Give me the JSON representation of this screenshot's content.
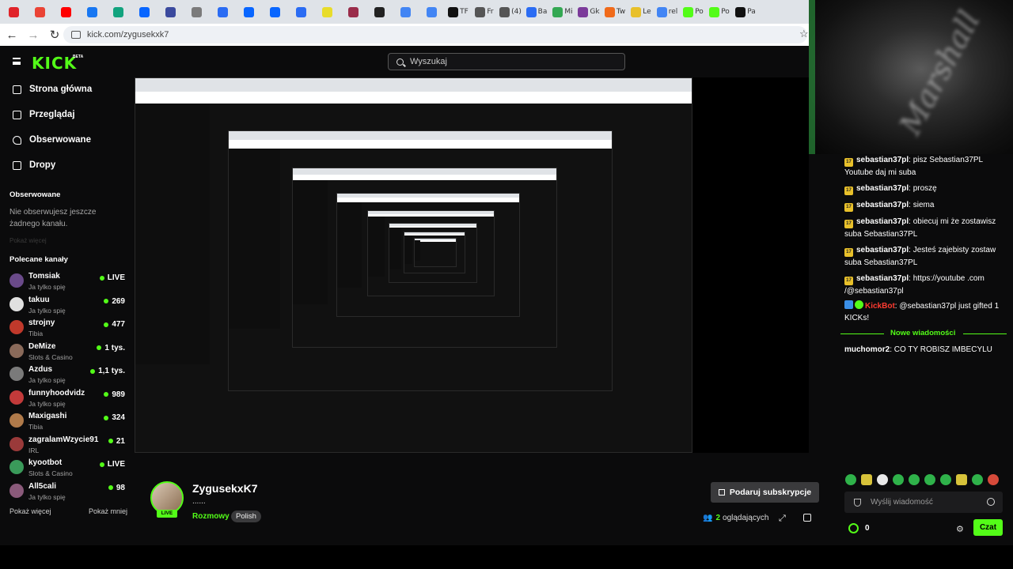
{
  "browser": {
    "tabs": [
      {
        "label": "",
        "color": "#e0242a"
      },
      {
        "label": "",
        "color": "#ea4335"
      },
      {
        "label": "",
        "color": "#ff0000"
      },
      {
        "label": "",
        "color": "#1877f2"
      },
      {
        "label": "",
        "color": "#12a37e"
      },
      {
        "label": "",
        "color": "#0866ff"
      },
      {
        "label": "",
        "color": "#3b4a9e"
      },
      {
        "label": "",
        "color": "#7b7b7b"
      },
      {
        "label": "",
        "color": "#2b6cf3"
      },
      {
        "label": "",
        "color": "#0866ff"
      },
      {
        "label": "",
        "color": "#0866ff"
      },
      {
        "label": "",
        "color": "#2b6cf3"
      },
      {
        "label": "",
        "color": "#e8dc2a"
      },
      {
        "label": "",
        "color": "#9a2c4a"
      },
      {
        "label": "",
        "color": "#222222"
      },
      {
        "label": "",
        "color": "#4285f4"
      },
      {
        "label": "",
        "color": "#4285f4"
      },
      {
        "label": "TF",
        "color": "#111111"
      },
      {
        "label": "Fr",
        "color": "#555555"
      },
      {
        "label": "(4)",
        "color": "#555555"
      },
      {
        "label": "Ba",
        "color": "#2b6cf3"
      },
      {
        "label": "Mi",
        "color": "#34a853"
      },
      {
        "label": "Gk",
        "color": "#7b3a9a"
      },
      {
        "label": "Tw",
        "color": "#f06a1a"
      },
      {
        "label": "Le",
        "color": "#e8c02a"
      },
      {
        "label": "rel",
        "color": "#4285f4"
      },
      {
        "label": "Po",
        "color": "#53fc18"
      },
      {
        "label": "Po",
        "color": "#53fc18"
      },
      {
        "label": "Pa",
        "color": "#111111"
      }
    ],
    "url": "kick.com/zygusekxk7"
  },
  "header": {
    "logo": "KICK",
    "beta": "BETA",
    "search_placeholder": "Wyszukaj"
  },
  "sidebar": {
    "nav": [
      {
        "label": "Strona główna",
        "icon": "home-icon"
      },
      {
        "label": "Przeglądaj",
        "icon": "browse-icon"
      },
      {
        "label": "Obserwowane",
        "icon": "heart-icon"
      },
      {
        "label": "Dropy",
        "icon": "gift-icon"
      }
    ],
    "followed_title": "Obserwowane",
    "followed_empty": "Nie obserwujesz jeszcze żadnego kanału.",
    "followed_faded": "Pokaż więcej",
    "recommended_title": "Polecane kanały",
    "channels": [
      {
        "name": "Tomsiak",
        "category": "Ja tylko spię",
        "count": "LIVE",
        "color": "#6a4a8a"
      },
      {
        "name": "takuu",
        "category": "Ja tylko spię",
        "count": "269",
        "color": "#e0e0e0"
      },
      {
        "name": "strojny",
        "category": "Tibia",
        "count": "477",
        "color": "#c0392b"
      },
      {
        "name": "DeMize",
        "category": "Slots & Casino",
        "count": "1 tys.",
        "color": "#8a6a5a"
      },
      {
        "name": "Azdus",
        "category": "Ja tylko spię",
        "count": "1,1 tys.",
        "color": "#7a7a7a"
      },
      {
        "name": "funnyhoodvidz",
        "category": "Ja tylko spię",
        "count": "989",
        "color": "#c23a3a"
      },
      {
        "name": "Maxigashi",
        "category": "Tibia",
        "count": "324",
        "color": "#b07a4a"
      },
      {
        "name": "zagralamWzycie91",
        "category": "IRL",
        "count": "21",
        "color": "#9a3a3a"
      },
      {
        "name": "kyootbot",
        "category": "Slots & Casino",
        "count": "LIVE",
        "color": "#3a9a5a"
      },
      {
        "name": "All5cali",
        "category": "Ja tylko spię",
        "count": "98",
        "color": "#8a5a7a"
      }
    ],
    "show_more": "Pokaż więcej",
    "show_less": "Pokaż mniej"
  },
  "channel": {
    "name": "ZygusekxK7",
    "title": "......",
    "live": "LIVE",
    "category": "Rozmowy",
    "language": "Polish",
    "subscribe_label": "Podaruj subskrypcje",
    "viewers_count": "2",
    "viewers_label": "oglądających"
  },
  "chat": {
    "messages": [
      {
        "user": "sebastian37pl",
        "text": "pisz Sebastian37PL Youtube daj mi suba"
      },
      {
        "user": "sebastian37pl",
        "text": "proszę"
      },
      {
        "user": "sebastian37pl",
        "text": "siema"
      },
      {
        "user": "sebastian37pl",
        "text": "obiecuj mi że zostawisz suba Sebastian37PL"
      },
      {
        "user": "sebastian37pl",
        "text": "Jesteś zajebisty zostaw suba Sebastian37PL"
      },
      {
        "user": "sebastian37pl",
        "text": "https://youtube .com /@sebastian37pl"
      }
    ],
    "bot_message": {
      "user": "KickBot",
      "text": "@sebastian37pl just gifted 1 KICKs!"
    },
    "new_messages_label": "Nowe wiadomości",
    "last_message": {
      "user": "muchomor2",
      "text": "CO TY ROBISZ IMBECYLU"
    },
    "input_placeholder": "Wyślij wiadomość",
    "points": "0",
    "send_label": "Czat",
    "badge_text": "17"
  },
  "webcam": {
    "text": "Marshall"
  },
  "accent": "#53fc18"
}
